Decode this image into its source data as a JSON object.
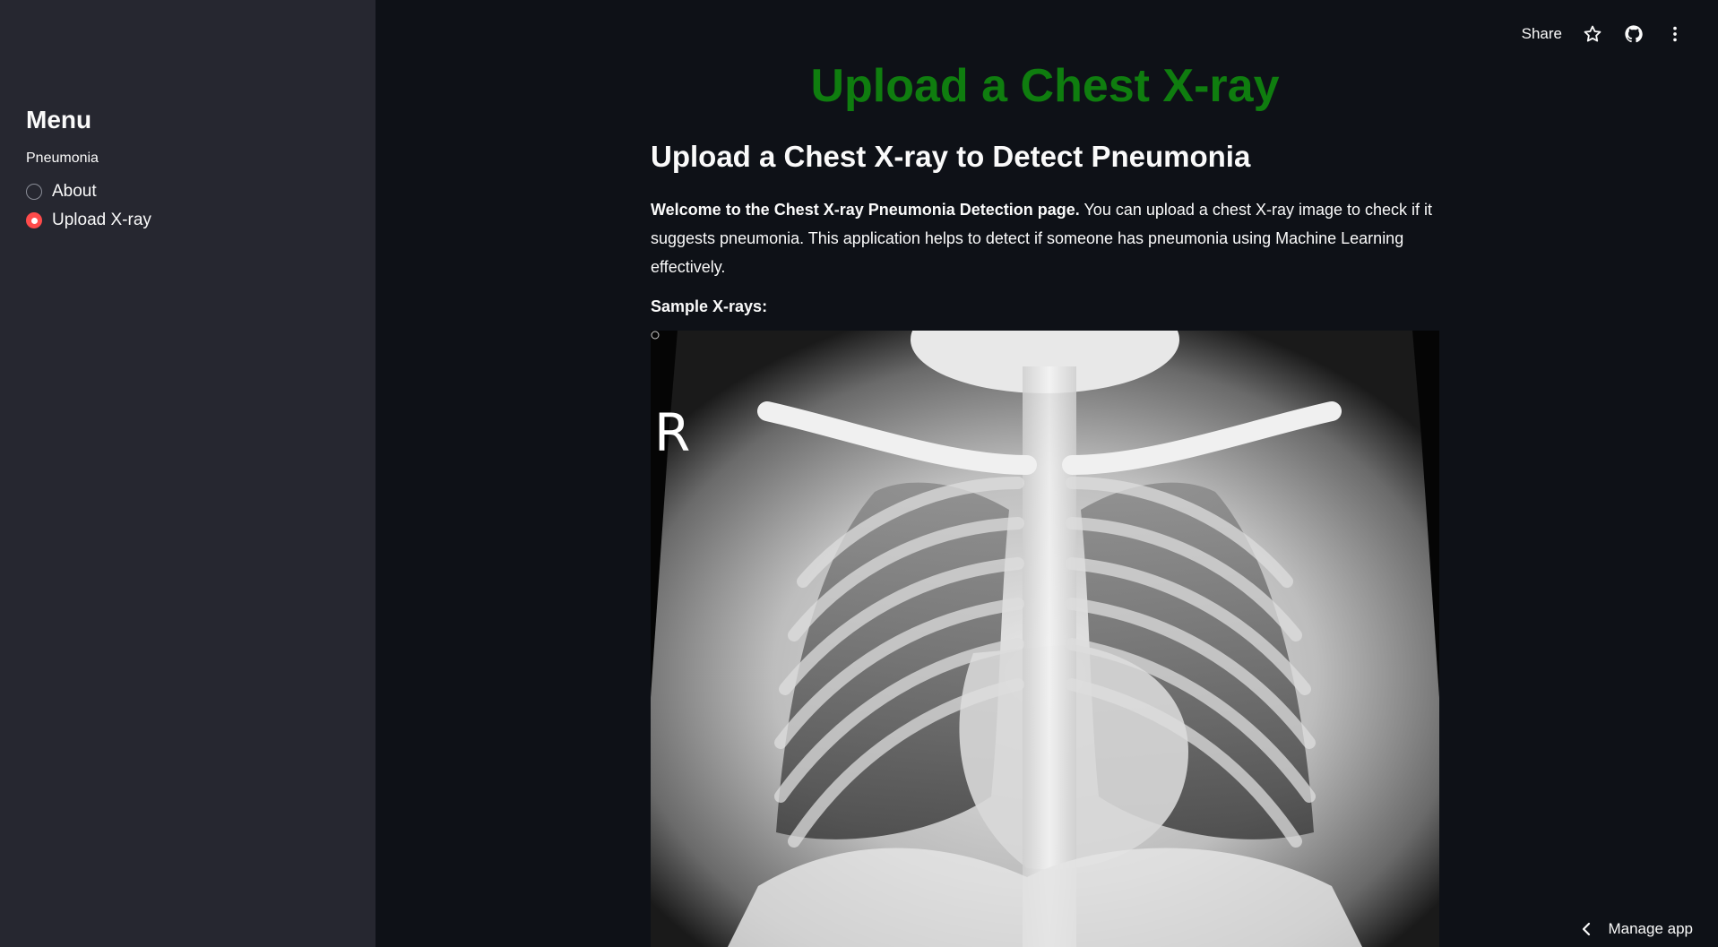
{
  "sidebar": {
    "title": "Menu",
    "radio_label": "Pneumonia",
    "options": [
      {
        "label": "About",
        "selected": false
      },
      {
        "label": "Upload X-ray",
        "selected": true
      }
    ]
  },
  "toolbar": {
    "share_label": "Share",
    "icons": [
      "star-icon",
      "github-icon",
      "more-vert-icon"
    ]
  },
  "main": {
    "title": "Upload a Chest X-ray",
    "subheader": "Upload a Chest X-ray to Detect Pneumonia",
    "intro_bold": "Welcome to the Chest X-ray Pneumonia Detection page.",
    "intro_rest": " You can upload a chest X-ray image to check if it suggests pneumonia. This application helps to detect if someone has pneumonia using Machine Learning effectively.",
    "sample_label": "Sample X-rays:",
    "xray_marker": "R"
  },
  "footer": {
    "manage_label": "Manage app"
  },
  "colors": {
    "title_green": "#0f7d0f",
    "accent": "#ff4b4b",
    "sidebar_bg": "#262730",
    "main_bg": "#0e1117"
  }
}
